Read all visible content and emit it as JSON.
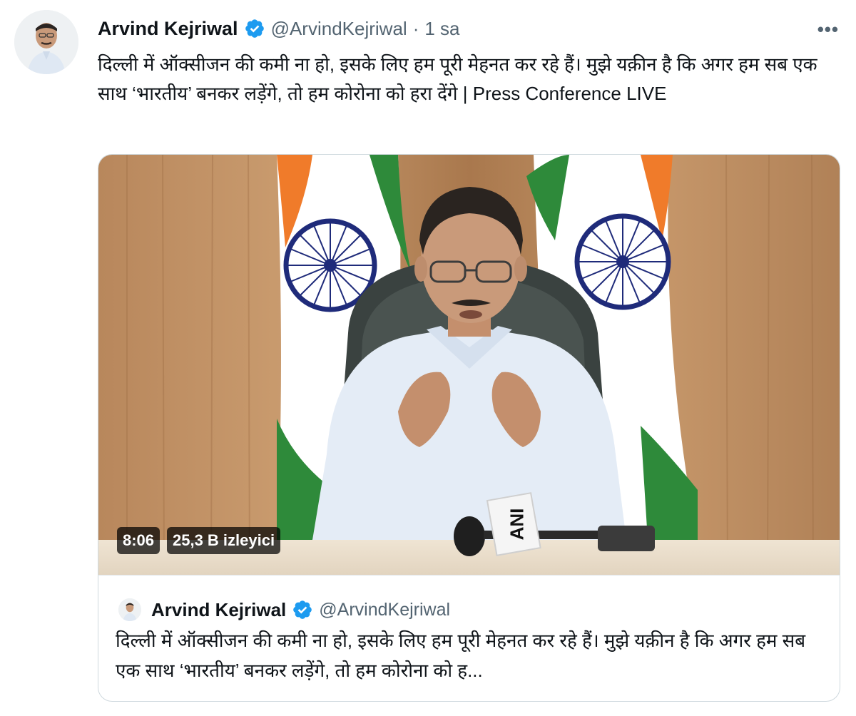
{
  "tweet": {
    "display_name": "Arvind Kejriwal",
    "handle": "@ArvindKejriwal",
    "separator": "·",
    "time": "1 sa",
    "more_label": "•••",
    "text": "दिल्ली में ऑक्सीजन की कमी ना हो, इसके लिए हम पूरी मेहनत कर रहे हैं। मुझे यक़ीन है कि अगर हम सब एक साथ ‘भारतीय’ बनकर लड़ेंगे, तो हम कोरोना को हरा देंगे | Press Conference LIVE"
  },
  "media": {
    "duration": "8:06",
    "viewers": "25,3 B izleyici",
    "mic_label": "ANI"
  },
  "quote": {
    "display_name": "Arvind Kejriwal",
    "handle": "@ArvindKejriwal",
    "text": "दिल्ली में ऑक्सीजन की कमी ना हो, इसके लिए हम पूरी मेहनत कर रहे हैं। मुझे यक़ीन है कि अगर हम सब एक साथ ‘भारतीय’ बनकर लड़ेंगे, तो हम कोरोना को ह..."
  },
  "icons": {
    "verified": "verified-badge-icon",
    "more": "more-options-icon"
  },
  "colors": {
    "verified_blue": "#1d9bf0",
    "text_secondary": "#536471",
    "border": "#cfd9de",
    "saffron": "#f07b2a",
    "flag_green": "#2e8a3a",
    "chakra_navy": "#1f2b7a"
  }
}
